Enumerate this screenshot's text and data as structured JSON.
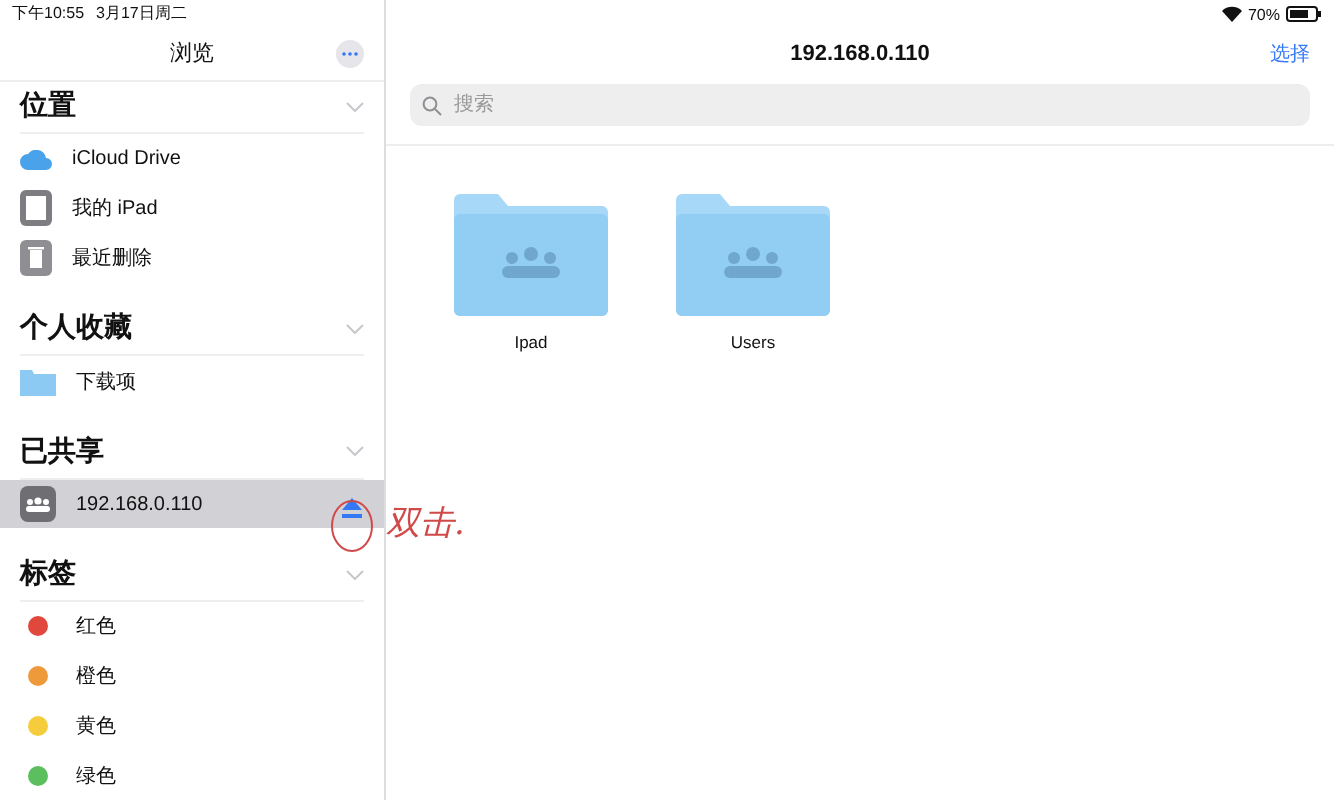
{
  "status_bar": {
    "time": "下午10:55",
    "date": "3月17日周二",
    "battery": "70%"
  },
  "sidebar": {
    "title": "浏览",
    "sections": [
      {
        "title": "位置",
        "items": [
          {
            "kind": "cloud",
            "label": "iCloud Drive",
            "selected": false
          },
          {
            "kind": "ipad",
            "label": "我的 iPad",
            "selected": false
          },
          {
            "kind": "trash",
            "label": "最近删除",
            "selected": false
          }
        ]
      },
      {
        "title": "个人收藏",
        "items": [
          {
            "kind": "folder",
            "label": "下载项",
            "selected": false
          }
        ]
      },
      {
        "title": "已共享",
        "items": [
          {
            "kind": "server",
            "label": "192.168.0.110",
            "selected": true
          }
        ]
      },
      {
        "title": "标签",
        "items": [
          {
            "kind": "tag",
            "label": "红色",
            "color": "#e0483e",
            "selected": false
          },
          {
            "kind": "tag",
            "label": "橙色",
            "color": "#ef9a3a",
            "selected": false
          },
          {
            "kind": "tag",
            "label": "黄色",
            "color": "#f5cd3c",
            "selected": false
          },
          {
            "kind": "tag",
            "label": "绿色",
            "color": "#5bbf5e",
            "selected": false
          }
        ]
      }
    ]
  },
  "main": {
    "title": "192.168.0.110",
    "action": "选择",
    "search": {
      "placeholder": "搜索"
    },
    "folders": [
      {
        "name": "Ipad"
      },
      {
        "name": "Users"
      }
    ]
  },
  "annotation": {
    "text": "双击."
  }
}
